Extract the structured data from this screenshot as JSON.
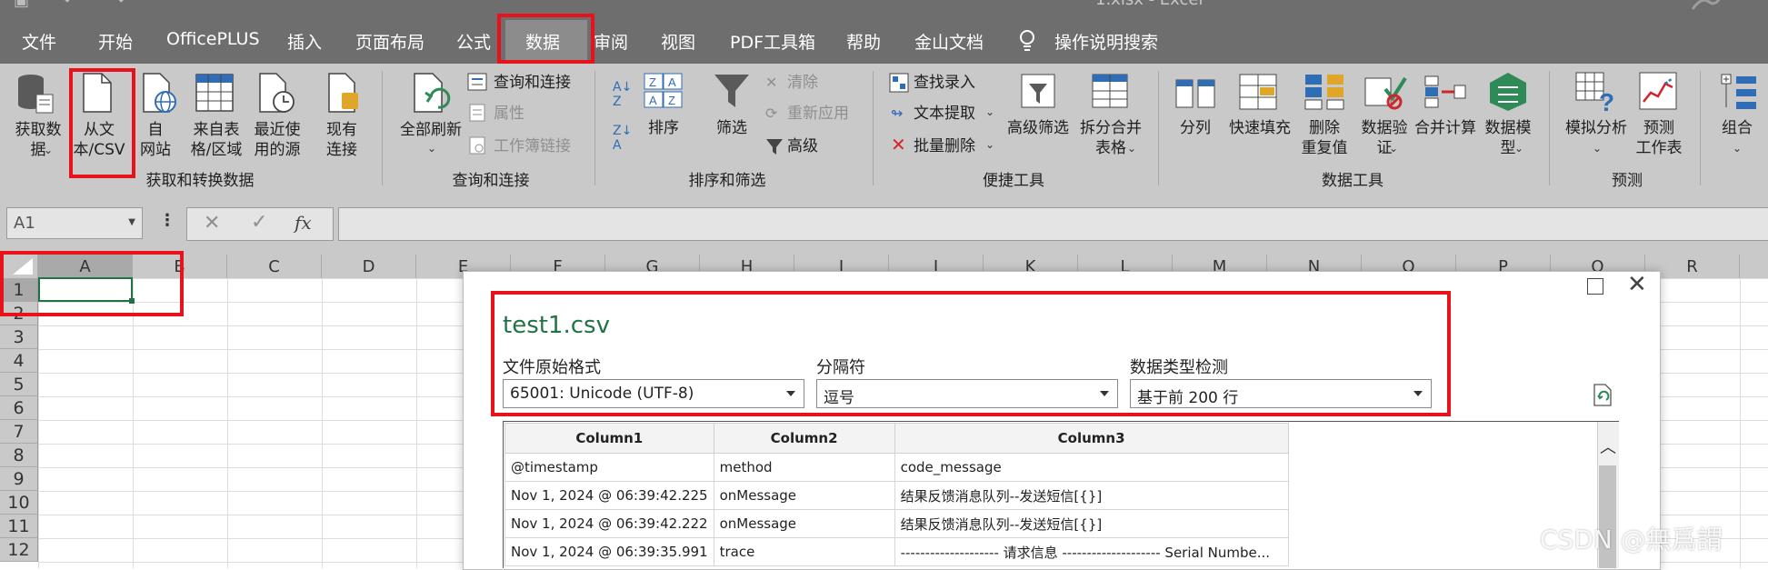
{
  "window": {
    "title": "1.xlsx  -  Excel"
  },
  "tabs": [
    {
      "label": "文件"
    },
    {
      "label": "开始"
    },
    {
      "label": "OfficePLUS"
    },
    {
      "label": "插入"
    },
    {
      "label": "页面布局"
    },
    {
      "label": "公式"
    },
    {
      "label": "数据"
    },
    {
      "label": "审阅"
    },
    {
      "label": "视图"
    },
    {
      "label": "PDF工具箱"
    },
    {
      "label": "帮助"
    },
    {
      "label": "金山文档"
    },
    {
      "label": "操作说明搜索"
    }
  ],
  "ribbon": {
    "get_data": [
      "获取数",
      "据"
    ],
    "from_csv": [
      "从文",
      "本/CSV"
    ],
    "from_web": [
      "自",
      "网站"
    ],
    "from_table": [
      "来自表",
      "格/区域"
    ],
    "recent_sources": [
      "最近使",
      "用的源"
    ],
    "existing": [
      "现有",
      "连接"
    ],
    "group_get": "获取和转换数据",
    "refresh_all": "全部刷新",
    "queries": "查询和连接",
    "properties": "属性",
    "edit_links": "工作簿链接",
    "group_queries": "查询和连接",
    "sort": "排序",
    "filter": "筛选",
    "clear": "清除",
    "reapply": "重新应用",
    "advanced": "高级",
    "group_sort": "排序和筛选",
    "find_entry": "查找录入",
    "text_extract": "文本提取",
    "batch_delete": "批量删除",
    "adv_filter": "高级筛选",
    "split_merge": [
      "拆分合并",
      "表格"
    ],
    "group_tools": "便捷工具",
    "text_to_cols": "分列",
    "flash_fill": "快速填充",
    "remove_dup": [
      "删除",
      "重复值"
    ],
    "validation": [
      "数据验",
      "证"
    ],
    "consolidate": "合并计算",
    "data_model": [
      "数据模",
      "型"
    ],
    "group_datatools": "数据工具",
    "what_if": "模拟分析",
    "forecast": [
      "预测",
      "工作表"
    ],
    "group_forecast": "预测",
    "group_outline": "组合"
  },
  "formula_bar": {
    "name_box": "A1",
    "fx": "fx",
    "formula": ""
  },
  "grid": {
    "columns": [
      "A",
      "B",
      "C",
      "D",
      "E",
      "F",
      "G",
      "H",
      "I",
      "J",
      "K",
      "L",
      "M",
      "N",
      "O",
      "P",
      "Q",
      "R"
    ],
    "rows": [
      "1",
      "2",
      "3",
      "4",
      "5",
      "6",
      "7",
      "8",
      "9",
      "10",
      "11",
      "12"
    ]
  },
  "dialog": {
    "file_name": "test1.csv",
    "origin_label": "文件原始格式",
    "origin_value": "65001: Unicode (UTF-8)",
    "delimiter_label": "分隔符",
    "delimiter_value": "逗号",
    "detect_label": "数据类型检测",
    "detect_value": "基于前 200 行",
    "headers": [
      "Column1",
      "Column2",
      "Column3"
    ],
    "rows": [
      [
        "@timestamp",
        "method",
        "code_message"
      ],
      [
        "Nov 1, 2024 @ 06:39:42.225",
        "onMessage",
        "结果反馈消息队列--发送短信[{}]"
      ],
      [
        "Nov 1, 2024 @ 06:39:42.222",
        "onMessage",
        "结果反馈消息队列--发送短信[{}]"
      ],
      [
        "Nov 1, 2024 @ 06:39:35.991",
        "trace",
        "-------------------- 请求信息 -------------------- Serial Numbe..."
      ]
    ]
  },
  "watermark": "CSDN @無爲謂",
  "colors": {
    "accent_red": "#e8121b",
    "title_green": "#217346",
    "tab_bar": "#6e6e6e",
    "ribbon": "#c9c9c9"
  }
}
